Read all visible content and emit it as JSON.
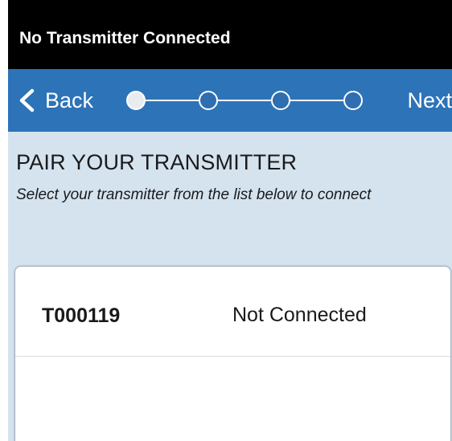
{
  "status_bar": {
    "text": "No Transmitter Connected"
  },
  "nav": {
    "back_label": "Back",
    "next_label": "Next",
    "progress": {
      "steps": 4,
      "current": 1
    }
  },
  "page": {
    "title": "PAIR YOUR TRANSMITTER",
    "subtitle": "Select your transmitter from the list below to connect"
  },
  "transmitters": [
    {
      "id": "T000119",
      "status": "Not Connected"
    }
  ],
  "colors": {
    "nav_blue": "#2d73b8",
    "content_bg": "#d5e3ef",
    "status_bg": "#000000",
    "step_dot": "#2e6eb1",
    "step_dot_current": "#e8ecf0"
  },
  "icons": {
    "back": "chevron-left-icon"
  }
}
